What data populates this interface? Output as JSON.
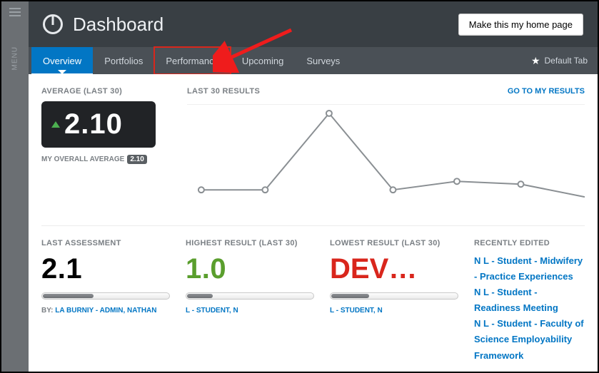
{
  "menu": {
    "label": "MENU"
  },
  "header": {
    "title": "Dashboard",
    "home_button": "Make this my home page"
  },
  "tabs": {
    "items": [
      {
        "label": "Overview",
        "active": true
      },
      {
        "label": "Portfolios"
      },
      {
        "label": "Performance",
        "highlight": true
      },
      {
        "label": "Upcoming"
      },
      {
        "label": "Surveys"
      }
    ],
    "default_tab_label": "Default Tab"
  },
  "average": {
    "section_label": "AVERAGE (LAST 30)",
    "value": "2.10",
    "overall_label": "MY OVERALL AVERAGE",
    "overall_value": "2.10"
  },
  "chart": {
    "section_label": "LAST 30 RESULTS",
    "goto_label": "GO TO MY RESULTS"
  },
  "chart_data": {
    "type": "line",
    "title": "Last 30 Results",
    "x": [
      1,
      2,
      3,
      4,
      5,
      6,
      7
    ],
    "values": [
      1.0,
      1.0,
      3.5,
      1.0,
      1.2,
      1.1,
      0.7
    ],
    "ylim": [
      0,
      4
    ],
    "xlabel": "",
    "ylabel": ""
  },
  "last_assessment": {
    "section_label": "LAST ASSESSMENT",
    "value": "2.1",
    "bar_pct": 40,
    "by_prefix": "BY:",
    "by_value": "LA BURNIY - ADMIN, NATHAN"
  },
  "highest": {
    "section_label": "HIGHEST RESULT (LAST 30)",
    "value": "1.0",
    "bar_pct": 20,
    "by_value": "L - STUDENT, N"
  },
  "lowest": {
    "section_label": "LOWEST RESULT (LAST 30)",
    "value": "DEV…",
    "bar_pct": 30,
    "by_value": "L - STUDENT, N"
  },
  "recent": {
    "section_label": "RECENTLY EDITED",
    "items": [
      "N L - Student - Midwifery - Practice Experiences",
      "N L - Student - Readiness Meeting",
      "N L - Student - Faculty of Science Employability Framework"
    ]
  }
}
